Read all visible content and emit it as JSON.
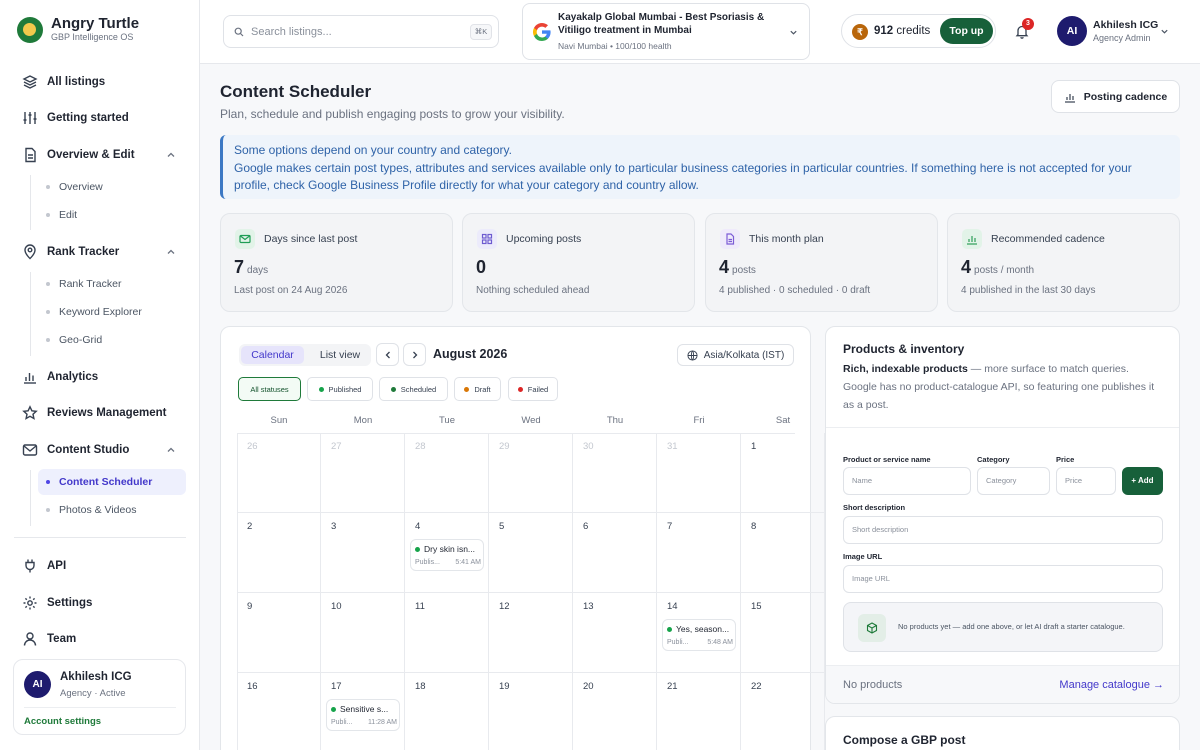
{
  "brand": {
    "name": "Angry Turtle",
    "tagline": "GBP Intelligence OS"
  },
  "sidebar": {
    "items": [
      {
        "label": "All listings",
        "icon": "layers-icon"
      },
      {
        "label": "Getting started",
        "icon": "sliders-icon"
      },
      {
        "label": "Overview & Edit",
        "icon": "document-icon",
        "expanded": true,
        "children": [
          {
            "label": "Overview"
          },
          {
            "label": "Edit"
          }
        ]
      },
      {
        "label": "Rank Tracker",
        "icon": "map-pin-icon",
        "expanded": true,
        "children": [
          {
            "label": "Rank Tracker"
          },
          {
            "label": "Keyword Explorer"
          },
          {
            "label": "Geo-Grid"
          }
        ]
      },
      {
        "label": "Analytics",
        "icon": "bar-chart-icon"
      },
      {
        "label": "Reviews Management",
        "icon": "star-icon"
      },
      {
        "label": "Content Studio",
        "icon": "mail-icon",
        "expanded": true,
        "children": [
          {
            "label": "Content Scheduler",
            "active": true
          },
          {
            "label": "Photos & Videos"
          }
        ]
      }
    ],
    "bottom": [
      {
        "label": "API",
        "icon": "plug-icon"
      },
      {
        "label": "Settings",
        "icon": "gear-icon"
      },
      {
        "label": "Team",
        "icon": "user-icon"
      }
    ],
    "user": {
      "initials": "AI",
      "name": "Akhilesh ICG",
      "role": "Agency · Active",
      "link": "Account settings"
    }
  },
  "topbar": {
    "search_placeholder": "Search listings...",
    "search_shortcut": "⌘K",
    "location": {
      "title": "Kayakalp Global Mumbai - Best Psoriasis & Vitiligo treatment in Mumbai",
      "subtitle": "Navi Mumbai • 100/100 health"
    },
    "credits": {
      "symbol": "₹",
      "amount": "912",
      "unit": "credits",
      "topup": "Top up"
    },
    "notifications": "3",
    "user": {
      "initials": "AI",
      "name": "Akhilesh ICG",
      "role": "Agency Admin"
    }
  },
  "page": {
    "title": "Content Scheduler",
    "subtitle": "Plan, schedule and publish engaging posts to grow your visibility.",
    "cadence_button": "Posting cadence"
  },
  "notice": {
    "heading": "Some options depend on your country and category.",
    "body": "Google makes certain post types, attributes and services available only to particular business categories in particular countries. If something here is not accepted for your profile, check Google Business Profile directly for what your category and country allow."
  },
  "stats": [
    {
      "label": "Days since last post",
      "value": "7",
      "unit": "days",
      "note": "Last post on 24 Aug 2026",
      "color": "#1f9d55",
      "icon": "mail-icon"
    },
    {
      "label": "Upcoming posts",
      "value": "0",
      "unit": "",
      "note": "Nothing scheduled ahead",
      "color": "#6d5bd0",
      "icon": "grid-icon"
    },
    {
      "label": "This month plan",
      "value": "4",
      "unit": "posts",
      "note": "4 published · 0 scheduled · 0 draft",
      "color": "#7c5cd6",
      "icon": "file-icon"
    },
    {
      "label": "Recommended cadence",
      "value": "4",
      "unit": "posts / month",
      "note": "4 published in the last 30 days",
      "color": "#2f9e5a",
      "icon": "chart-icon"
    }
  ],
  "calendar": {
    "tabs": [
      "Calendar",
      "List view"
    ],
    "month": "August 2026",
    "timezone": "Asia/Kolkata (IST)",
    "filters": [
      {
        "label": "All statuses",
        "color": ""
      },
      {
        "label": "Published",
        "color": "#16a34a"
      },
      {
        "label": "Scheduled",
        "color": "#1f7a3a"
      },
      {
        "label": "Draft",
        "color": "#d97706"
      },
      {
        "label": "Failed",
        "color": "#dc2626"
      }
    ],
    "weekdays": [
      "Sun",
      "Mon",
      "Tue",
      "Wed",
      "Thu",
      "Fri",
      "Sat"
    ],
    "weeks": [
      [
        {
          "d": "26",
          "dim": true
        },
        {
          "d": "27",
          "dim": true
        },
        {
          "d": "28",
          "dim": true
        },
        {
          "d": "29",
          "dim": true
        },
        {
          "d": "30",
          "dim": true
        },
        {
          "d": "31",
          "dim": true
        },
        {
          "d": "1"
        }
      ],
      [
        {
          "d": "2"
        },
        {
          "d": "3"
        },
        {
          "d": "4",
          "event": {
            "title": "Dry skin isn...",
            "status": "Publis...",
            "time": "5:41 AM"
          }
        },
        {
          "d": "5"
        },
        {
          "d": "6"
        },
        {
          "d": "7"
        },
        {
          "d": "8"
        }
      ],
      [
        {
          "d": "9"
        },
        {
          "d": "10"
        },
        {
          "d": "11"
        },
        {
          "d": "12"
        },
        {
          "d": "13"
        },
        {
          "d": "14",
          "event": {
            "title": "Yes, season...",
            "status": "Publi...",
            "time": "5:48 AM"
          }
        },
        {
          "d": "15"
        }
      ],
      [
        {
          "d": "16"
        },
        {
          "d": "17",
          "event": {
            "title": "Sensitive s...",
            "status": "Publi...",
            "time": "11:28 AM"
          }
        },
        {
          "d": "18"
        },
        {
          "d": "19"
        },
        {
          "d": "20"
        },
        {
          "d": "21"
        },
        {
          "d": "22"
        }
      ]
    ]
  },
  "products": {
    "title": "Products & inventory",
    "desc_bold": "Rich, indexable products",
    "desc_rest": " — more surface to match queries. Google has no product-catalogue API, so featuring one publishes it as a post.",
    "fields": {
      "name_label": "Product or service name",
      "name_ph": "Name",
      "category_label": "Category",
      "category_ph": "Category",
      "price_label": "Price",
      "price_ph": "Price",
      "desc_label": "Short description",
      "desc_ph": "Short description",
      "image_label": "Image URL",
      "image_ph": "Image URL"
    },
    "add_button": "+ Add",
    "empty_text": "No products yet — add one above, or let AI draft a starter catalogue.",
    "footer_left": "No products",
    "footer_link": "Manage catalogue →"
  },
  "compose": {
    "title": "Compose a GBP post"
  }
}
